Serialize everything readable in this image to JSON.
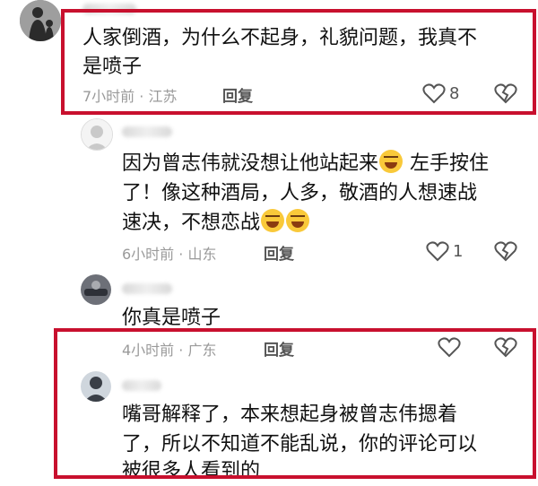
{
  "comments": [
    {
      "text_lines": [
        "人家倒酒，为什么不起身，礼貌问题，我真不",
        "是喷子"
      ],
      "meta": "7小时前 · 江苏",
      "reply_label": "回复",
      "likes": "8"
    },
    {
      "text_lines": [
        "因为曾志伟就没想让他站起来",
        "左手按住",
        "了！像这种酒局，人多，敬酒的人想速战",
        "速决，不想恋战"
      ],
      "meta": "6小时前 · 山东",
      "reply_label": "回复",
      "likes": "1"
    },
    {
      "text_lines": [
        "你真是喷子"
      ],
      "meta": "4小时前 · 广东",
      "reply_label": "回复",
      "likes": ""
    },
    {
      "text_lines": [
        "嘴哥解释了，本来想起身被曾志伟摁着",
        "了，所以不知道不能乱说，你的评论可以",
        "被很多人看到的"
      ],
      "meta": "",
      "reply_label": "",
      "likes": ""
    }
  ],
  "colors": {
    "highlight": "#c8102e",
    "meta": "#9a9a9a"
  },
  "icons": [
    "heart-outline-icon",
    "dislike-broken-heart-icon",
    "laughing-emoji-icon",
    "sweat-smile-emoji-icon"
  ]
}
